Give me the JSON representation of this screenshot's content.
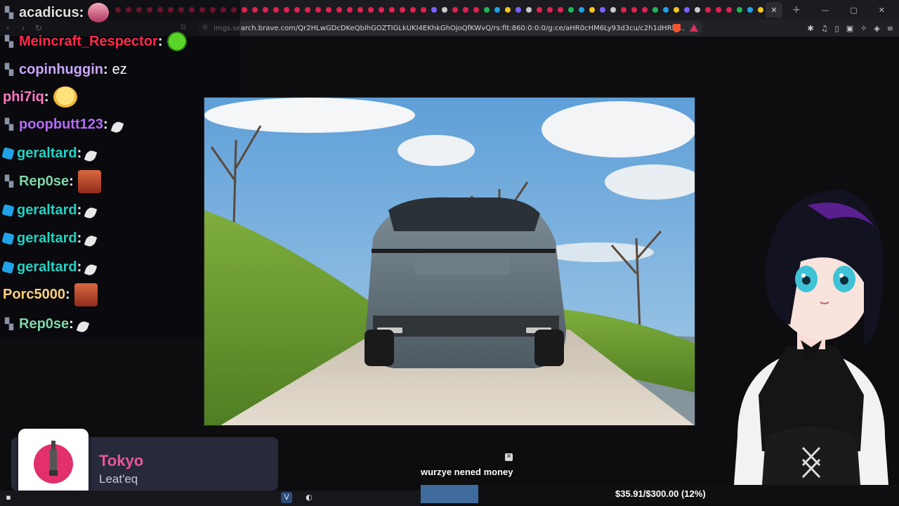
{
  "browser": {
    "url": "imgs.search.brave.com/Qr2HLwGDcDKeQblhGOZTIGLkUKI4EKhkGhOjoQfKWvQ/rs:fit:860:0:0:0/g:ce/aHR0cHM6Ly93d3cu/c2h1dHRlcnN0b2Nr/LmN...",
    "tab_count": 62,
    "new_tab_label": "+",
    "active_tab_close": "✕",
    "window_controls": {
      "minimize": "—",
      "maximize": "▢",
      "close": "✕"
    }
  },
  "chat": {
    "messages": [
      {
        "user": "acadicus",
        "color": "#e0e0e0",
        "badge": "mini",
        "emote": "anime",
        "text": ""
      },
      {
        "user": "Meincraft_Respector",
        "color": "#ff2a4b",
        "badge": "mini",
        "emote": "pepe",
        "text": ""
      },
      {
        "user": "copinhuggin",
        "color": "#c9a8ff",
        "badge": "mini",
        "emote": "",
        "text": "ez"
      },
      {
        "user": "phi7iq",
        "color": "#ff79c6",
        "badge": "",
        "emote": "laugh",
        "text": ""
      },
      {
        "user": "poopbutt123",
        "color": "#b66bff",
        "badge": "mini",
        "emote": "feather",
        "text": ""
      },
      {
        "user": "geraltard",
        "color": "#1fd3c6",
        "badge": "cube",
        "emote": "feather",
        "text": ""
      },
      {
        "user": "Rep0se",
        "color": "#7fd6a8",
        "badge": "mini",
        "emote": "face",
        "text": ""
      },
      {
        "user": "geraltard",
        "color": "#1fd3c6",
        "badge": "cube",
        "emote": "feather",
        "text": ""
      },
      {
        "user": "geraltard",
        "color": "#1fd3c6",
        "badge": "cube",
        "emote": "feather",
        "text": ""
      },
      {
        "user": "geraltard",
        "color": "#1fd3c6",
        "badge": "cube",
        "emote": "feather",
        "text": ""
      },
      {
        "user": "Porc5000",
        "color": "#ffd27a",
        "badge": "",
        "emote": "face",
        "text": ""
      },
      {
        "user": "Rep0se",
        "color": "#7fd6a8",
        "badge": "mini",
        "emote": "feather",
        "text": ""
      }
    ]
  },
  "now_playing": {
    "title": "Tokyo",
    "artist": "Leat'eq"
  },
  "donation": {
    "message": "wurzye nened money",
    "close_label": "✕",
    "goal_text": "$35.91/$300.00 (12%)",
    "progress_fraction": 0.12
  },
  "colors": {
    "accent_pink": "#e8589a",
    "card_bg": "#272a3b",
    "goal_fill": "#3f6c9d",
    "brave_orange": "#fb542b"
  }
}
